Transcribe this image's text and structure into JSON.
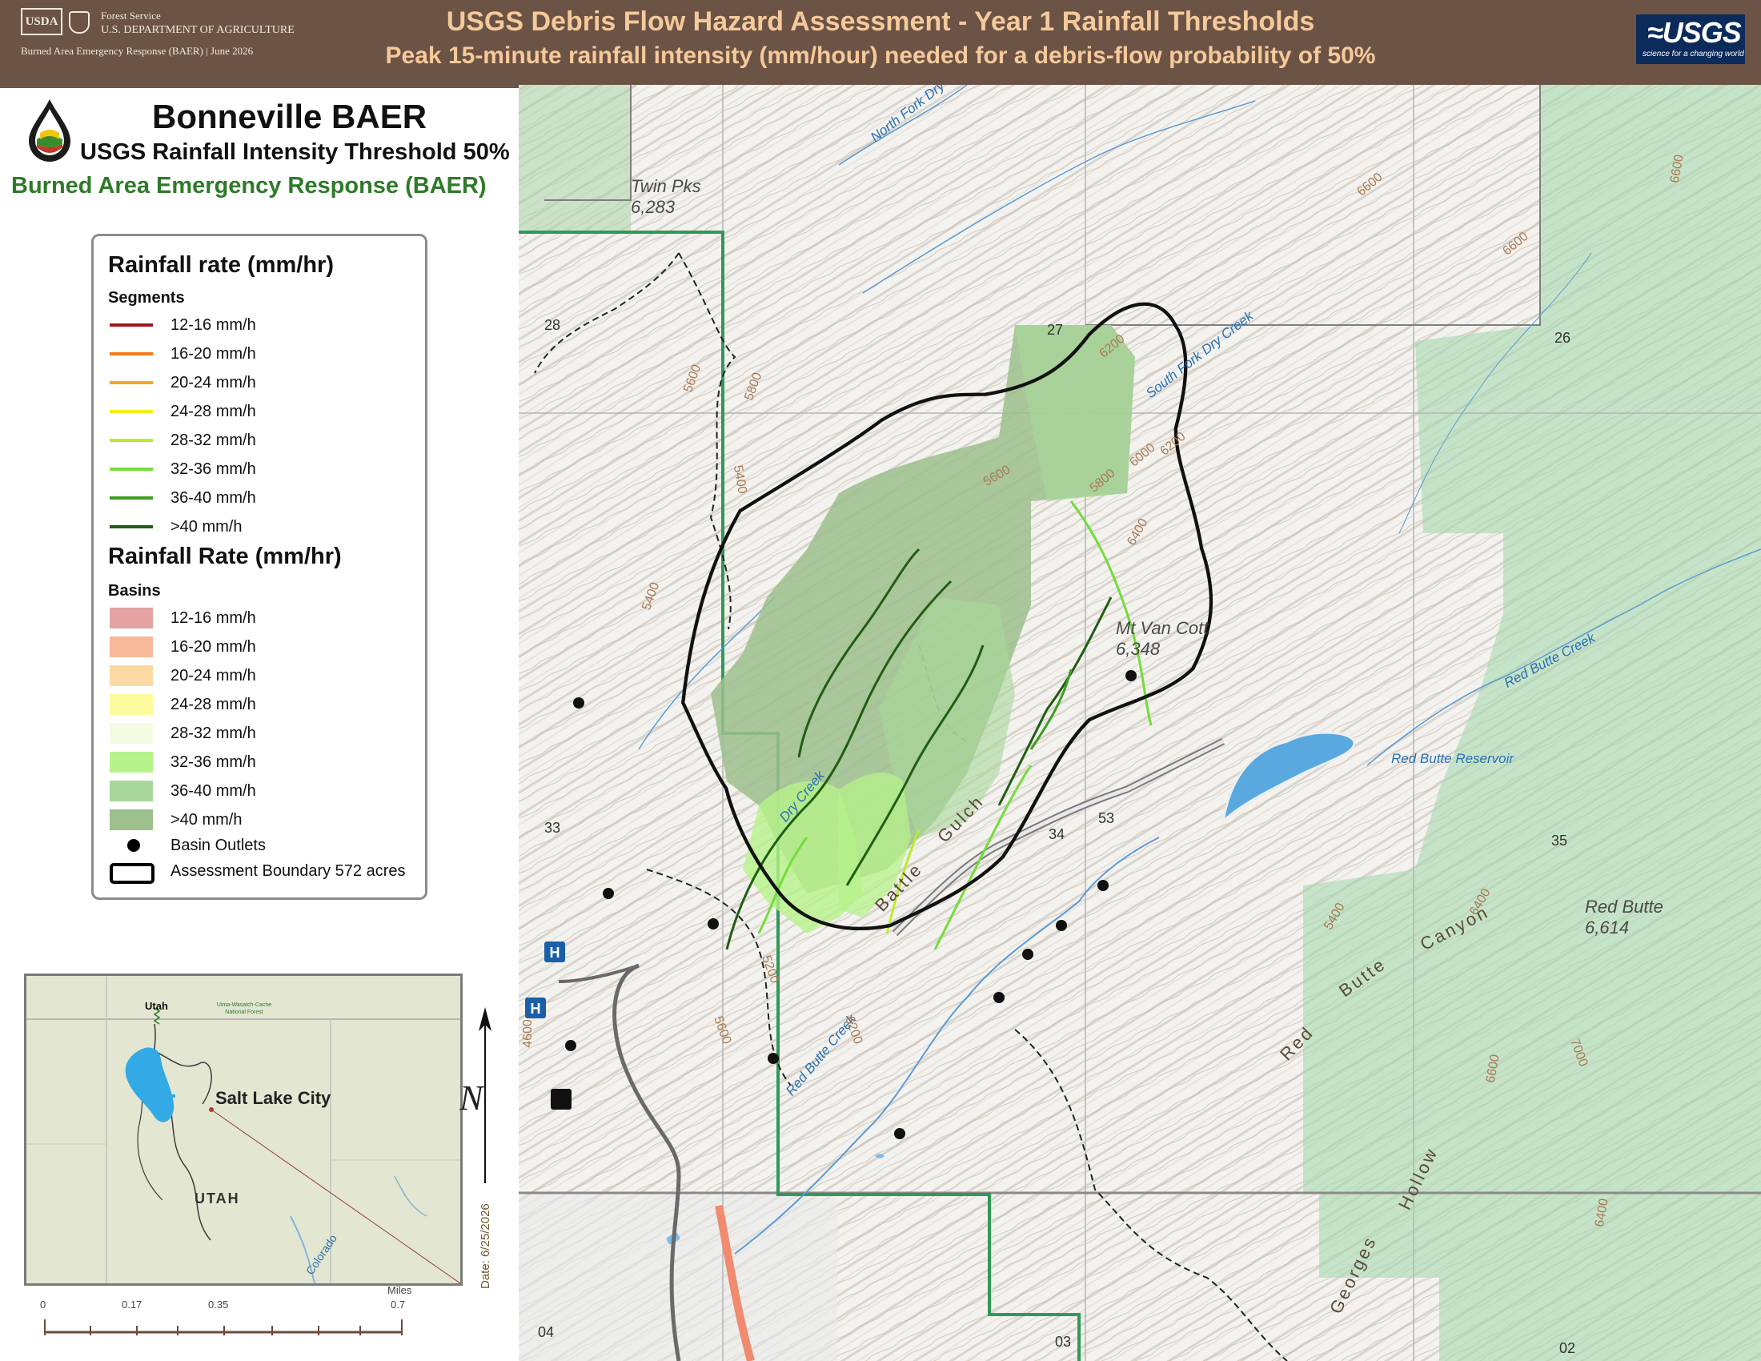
{
  "header": {
    "usda_label": "USDA",
    "agency_line1": "Forest Service",
    "agency_line2": "U.S. DEPARTMENT OF AGRICULTURE",
    "baer_line": "Burned Area Emergency Response (BAER) | June 2026",
    "title": "USGS Debris Flow Hazard Assessment  - Year 1 Rainfall Thresholds",
    "subtitle": "Peak 15-minute rainfall intensity (mm/hour) needed for a debris-flow probability of 50%",
    "usgs_logo": "≈USGS",
    "usgs_tagline": "science for a changing world"
  },
  "panel": {
    "title": "Bonneville BAER",
    "subtitle": "USGS Rainfall Intensity Threshold 50%",
    "baer": "Burned Area Emergency Response (BAER)"
  },
  "legend": {
    "segments_heading": "Rainfall rate (mm/hr)",
    "segments_sub": "Segments",
    "segments": [
      {
        "label": "12-16 mm/h",
        "color": "#a01818"
      },
      {
        "label": "16-20 mm/h",
        "color": "#f07a1a"
      },
      {
        "label": "20-24 mm/h",
        "color": "#f5a81c"
      },
      {
        "label": "24-28 mm/h",
        "color": "#f2ee1e"
      },
      {
        "label": "28-32 mm/h",
        "color": "#b9ec2c"
      },
      {
        "label": "32-36 mm/h",
        "color": "#74dc3a"
      },
      {
        "label": "36-40 mm/h",
        "color": "#3f9e22"
      },
      {
        "label": ">40 mm/h",
        "color": "#1f5e12"
      }
    ],
    "basins_heading": "Rainfall Rate (mm/hr)",
    "basins_sub": "Basins",
    "basins": [
      {
        "label": "12-16 mm/h",
        "color": "#e3a3a3"
      },
      {
        "label": "16-20 mm/h",
        "color": "#f8b89a"
      },
      {
        "label": "20-24 mm/h",
        "color": "#fbd9a3"
      },
      {
        "label": "24-28 mm/h",
        "color": "#fbfa9c"
      },
      {
        "label": "28-32 mm/h",
        "color": "#f4fbe3"
      },
      {
        "label": "32-36 mm/h",
        "color": "#b6f28a"
      },
      {
        "label": "36-40 mm/h",
        "color": "#a8d79a"
      },
      {
        "label": ">40 mm/h",
        "color": "#9cbf8c"
      }
    ],
    "outlets_label": "Basin Outlets",
    "boundary_label": "Assessment Boundary   572 acres"
  },
  "inset": {
    "state_label": "Utah",
    "forest_label": "Uinta-Wasatch-Cache National Forest",
    "city_label": "Salt Lake City",
    "region_label": "UTAH",
    "river_label": "Colorado"
  },
  "scale": {
    "unit": "Miles",
    "ticks": [
      "0",
      "0.17",
      "0.35",
      "0.7"
    ]
  },
  "north_label": "N",
  "date_label": "Date: 6/25/2026",
  "map": {
    "peaks": [
      {
        "name": "Twin Pks",
        "elev": "6,283"
      },
      {
        "name": "Mt Van Cott",
        "elev": "6,348"
      },
      {
        "name": "Red Butte",
        "elev": "6,614"
      }
    ],
    "creeks": [
      "North Fork Dry Creek",
      "South Fork Dry Creek",
      "Dry Creek",
      "Red Butte Creek",
      "Red Butte Creek",
      "Red Butte Reservoir"
    ],
    "features": [
      "Battle",
      "Gulch",
      "Red",
      "Butte",
      "Canyon",
      "Georges",
      "Hollow"
    ],
    "sections": [
      "28",
      "27",
      "26",
      "33",
      "34",
      "35",
      "04",
      "03",
      "02"
    ],
    "contours": [
      "6600",
      "6600",
      "6600",
      "6200",
      "5800",
      "6000",
      "6200",
      "5600",
      "5800",
      "5600",
      "5400",
      "5400",
      "6400",
      "5400",
      "6400",
      "6600",
      "7000",
      "6400",
      "6200",
      "5600",
      "5200",
      "4600"
    ],
    "road_label": "53"
  }
}
